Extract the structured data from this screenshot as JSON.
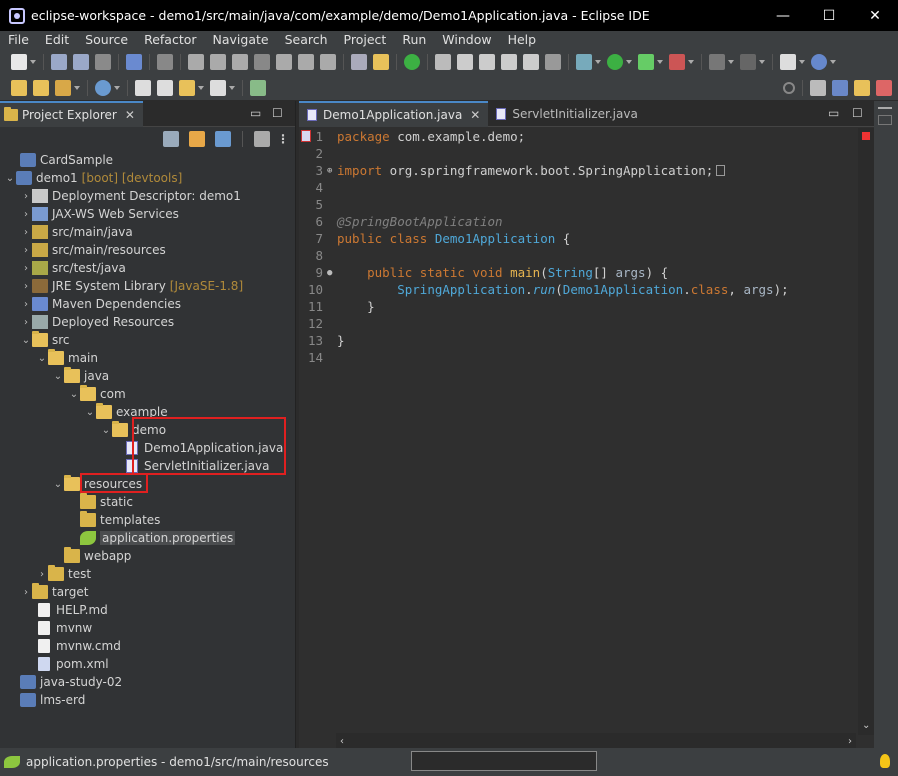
{
  "window": {
    "title": "eclipse-workspace - demo1/src/main/java/com/example/demo/Demo1Application.java - Eclipse IDE",
    "minimize_glyph": "—",
    "maximize_glyph": "☐",
    "close_glyph": "✕"
  },
  "menu": [
    "File",
    "Edit",
    "Source",
    "Refactor",
    "Navigate",
    "Search",
    "Project",
    "Run",
    "Window",
    "Help"
  ],
  "explorer": {
    "tab_label": "Project Explorer",
    "close_glyph": "✕",
    "minimize_glyph": "▭",
    "maximize_glyph": "☐",
    "tree": [
      {
        "label": "CardSample",
        "icon": "folder-icon"
      },
      {
        "label": "demo1",
        "deco": "[boot] [devtools]",
        "icon": "project-icon"
      },
      {
        "label": "Deployment Descriptor: demo1",
        "icon": "descriptor-icon"
      },
      {
        "label": "JAX-WS Web Services",
        "icon": "webservice-icon"
      },
      {
        "label": "src/main/java",
        "icon": "source-folder-icon"
      },
      {
        "label": "src/main/resources",
        "icon": "source-folder-icon"
      },
      {
        "label": "src/test/java",
        "icon": "source-folder-icon"
      },
      {
        "label": "JRE System Library",
        "deco": "[JavaSE-1.8]",
        "icon": "library-icon"
      },
      {
        "label": "Maven Dependencies",
        "icon": "library-icon"
      },
      {
        "label": "Deployed Resources",
        "icon": "deployed-icon"
      },
      {
        "label": "src",
        "icon": "folder-icon"
      },
      {
        "label": "main",
        "icon": "folder-icon"
      },
      {
        "label": "java",
        "icon": "folder-icon"
      },
      {
        "label": "com",
        "icon": "folder-icon"
      },
      {
        "label": "example",
        "icon": "folder-icon"
      },
      {
        "label": "demo",
        "icon": "folder-icon"
      },
      {
        "label": "Demo1Application.java",
        "icon": "java-file-icon"
      },
      {
        "label": "ServletInitializer.java",
        "icon": "java-file-icon"
      },
      {
        "label": "resources",
        "icon": "folder-icon"
      },
      {
        "label": "static",
        "icon": "folder-icon"
      },
      {
        "label": "templates",
        "icon": "folder-icon"
      },
      {
        "label": "application.properties",
        "icon": "properties-leaf-icon"
      },
      {
        "label": "webapp",
        "icon": "folder-icon"
      },
      {
        "label": "test",
        "icon": "folder-icon"
      },
      {
        "label": "target",
        "icon": "folder-icon"
      },
      {
        "label": "HELP.md",
        "icon": "markdown-file-icon"
      },
      {
        "label": "mvnw",
        "icon": "file-icon"
      },
      {
        "label": "mvnw.cmd",
        "icon": "file-icon"
      },
      {
        "label": "pom.xml",
        "icon": "maven-pom-icon"
      },
      {
        "label": "java-study-02",
        "icon": "project-icon"
      },
      {
        "label": "lms-erd",
        "icon": "project-icon"
      }
    ]
  },
  "editor": {
    "tabs": [
      {
        "label": "Demo1Application.java",
        "active": true
      },
      {
        "label": "ServletInitializer.java",
        "active": false
      }
    ],
    "close_glyph": "✕",
    "minimize_glyph": "▭",
    "maximize_glyph": "☐",
    "line_numbers": [
      "1",
      "2",
      "3",
      "4",
      "5",
      "6",
      "7",
      "8",
      "9",
      "10",
      "11",
      "12",
      "13",
      "14"
    ],
    "code": {
      "l1_kw": "package",
      "l1_rest": " com.example.demo;",
      "l3_kw": "import",
      "l3_rest": " org.springframework.boot.SpringApplication;",
      "l6": "@SpringBootApplication",
      "l7_kw": "public class",
      "l7_cls": "Demo1Application",
      "l7_rest": " {",
      "l9_kw": "public static void",
      "l9_mth": "main",
      "l9_open": "(",
      "l9_type": "String",
      "l9_arr": "[] ",
      "l9_arg": "args",
      "l9_close": ") {",
      "l10_cls": "SpringApplication",
      "l10_dot": ".",
      "l10_mth": "run",
      "l10_open": "(",
      "l10_cls2": "Demo1Application",
      "l10_dot2": ".",
      "l10_kw": "class",
      "l10_sep": ", ",
      "l10_arg": "args",
      "l10_close": ");",
      "l11": "}",
      "l13": "}"
    }
  },
  "status": {
    "text": "application.properties - demo1/src/main/resources"
  },
  "colors": {
    "highlight_box": "#e02020",
    "keyword": "#cc7832",
    "type": "#4fa8d8",
    "method": "#e6b450"
  }
}
